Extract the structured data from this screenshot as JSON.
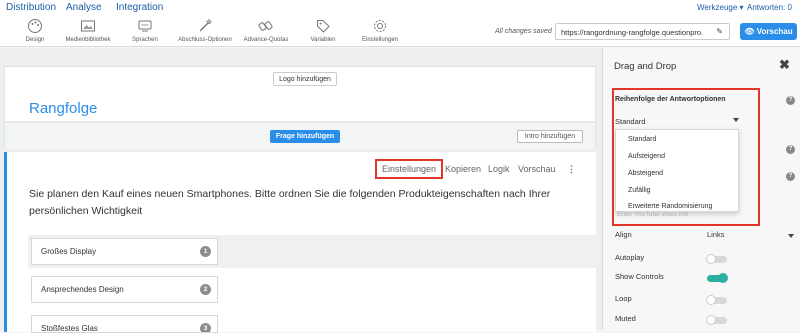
{
  "topnav": {
    "tabs": [
      "Distribution",
      "Analyse",
      "Integration"
    ],
    "werkzeuge": "Werkzeuge ▾",
    "antworten": "Antworten: 0"
  },
  "toolbar": {
    "tools": [
      {
        "label": "Design",
        "icon": "palette-icon"
      },
      {
        "label": "Medienbibliothek",
        "icon": "image-icon"
      },
      {
        "label": "Sprachen",
        "icon": "language-icon"
      },
      {
        "label": "Abschluss-Optionen",
        "icon": "magic-wand-icon"
      },
      {
        "label": "Advance-Quotas",
        "icon": "quota-icon"
      },
      {
        "label": "Variablen",
        "icon": "tag-icon"
      },
      {
        "label": "Einstellungen",
        "icon": "gear-icon"
      }
    ],
    "saved": "All changes saved",
    "url": "https://rangordnung-rangfolge.questionpro.",
    "vorschau": "Vorschau"
  },
  "survey": {
    "logo_button": "Logo hinzufügen",
    "title": "Rangfolge",
    "add_question": "Frage hinzufügen",
    "intro_button": "Intro hinzufügen"
  },
  "question": {
    "actions": [
      "Einstellungen",
      "Kopieren",
      "Logik",
      "Vorschau"
    ],
    "text": "Sie planen den Kauf eines neuen Smartphones. Bitte ordnen Sie die folgenden Produkteigenschaften nach Ihrer persönlichen Wichtigkeit",
    "options": [
      {
        "label": "Großes Display",
        "rank": "1"
      },
      {
        "label": "Ansprechendes Design",
        "rank": "2"
      },
      {
        "label": "Stoßfestes Glas",
        "rank": "3"
      }
    ]
  },
  "panel": {
    "title": "Drag and Drop",
    "close": "✖",
    "order_label": "Reihenfolge der Antwortoptionen",
    "order_value": "Standard",
    "order_options": [
      "Standard",
      "Aufsteigend",
      "Absteigend",
      "Zufällig",
      "Erweiterte Randomisierung"
    ],
    "video_hint": "Enter YouTube video link",
    "align_label": "Align",
    "align_value": "Links",
    "settings": [
      {
        "label": "Autoplay",
        "on": false
      },
      {
        "label": "Show Controls",
        "on": true
      },
      {
        "label": "Loop",
        "on": false
      },
      {
        "label": "Muted",
        "on": false
      }
    ],
    "accent": "#2ab0a0"
  }
}
